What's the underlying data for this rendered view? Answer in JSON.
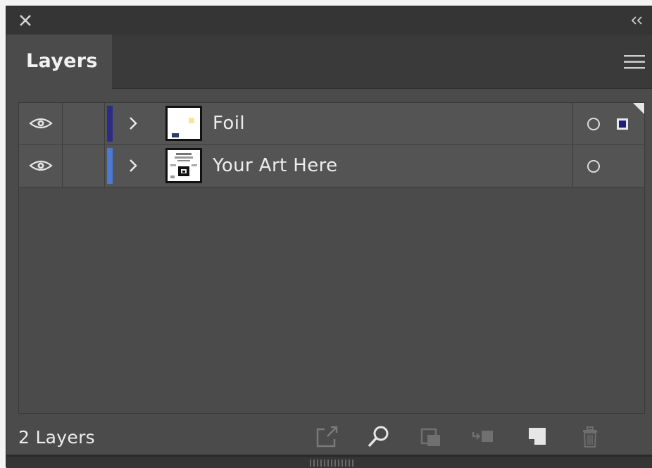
{
  "panel": {
    "tab_label": "Layers",
    "icons": {
      "close": "close-icon",
      "collapse": "double-chevron-icon",
      "menu": "hamburger-menu-icon"
    }
  },
  "layers": [
    {
      "name": "Foil",
      "color": "#2b2b8a",
      "selected_art": true
    },
    {
      "name": "Your Art Here",
      "color": "#4a7ad6",
      "selected_art": false
    }
  ],
  "footer": {
    "layer_count": "2 Layers",
    "buttons": [
      "export-icon",
      "search-icon",
      "clipping-mask-icon",
      "sublayer-icon",
      "new-layer-icon",
      "trash-icon"
    ]
  },
  "colors": {
    "panel_bg": "#4b4b4b",
    "row_bg": "#545454",
    "header_bg": "#353535"
  }
}
